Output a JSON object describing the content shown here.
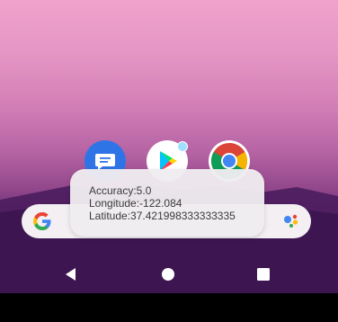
{
  "toast": {
    "accuracy": "Accuracy:5.0",
    "longitude": "Longitude:-122.084",
    "latitude": "Latitude:37.421998333333335"
  },
  "dock": {
    "apps": [
      {
        "icon": "messages-icon"
      },
      {
        "icon": "play-store-icon",
        "has_notification_dot": true
      },
      {
        "icon": "chrome-icon"
      }
    ]
  },
  "search_bar": {
    "left_icon": "google-g-icon",
    "right_icon": "assistant-icon"
  },
  "nav": {
    "back": "back-icon",
    "home": "home-icon",
    "recents": "recents-icon"
  },
  "colors": {
    "wallpaper_top": "#f0a2cc",
    "wallpaper_bottom": "#3a1750",
    "toast_bg": "#efecef",
    "messages_blue": "#2f74e6"
  }
}
